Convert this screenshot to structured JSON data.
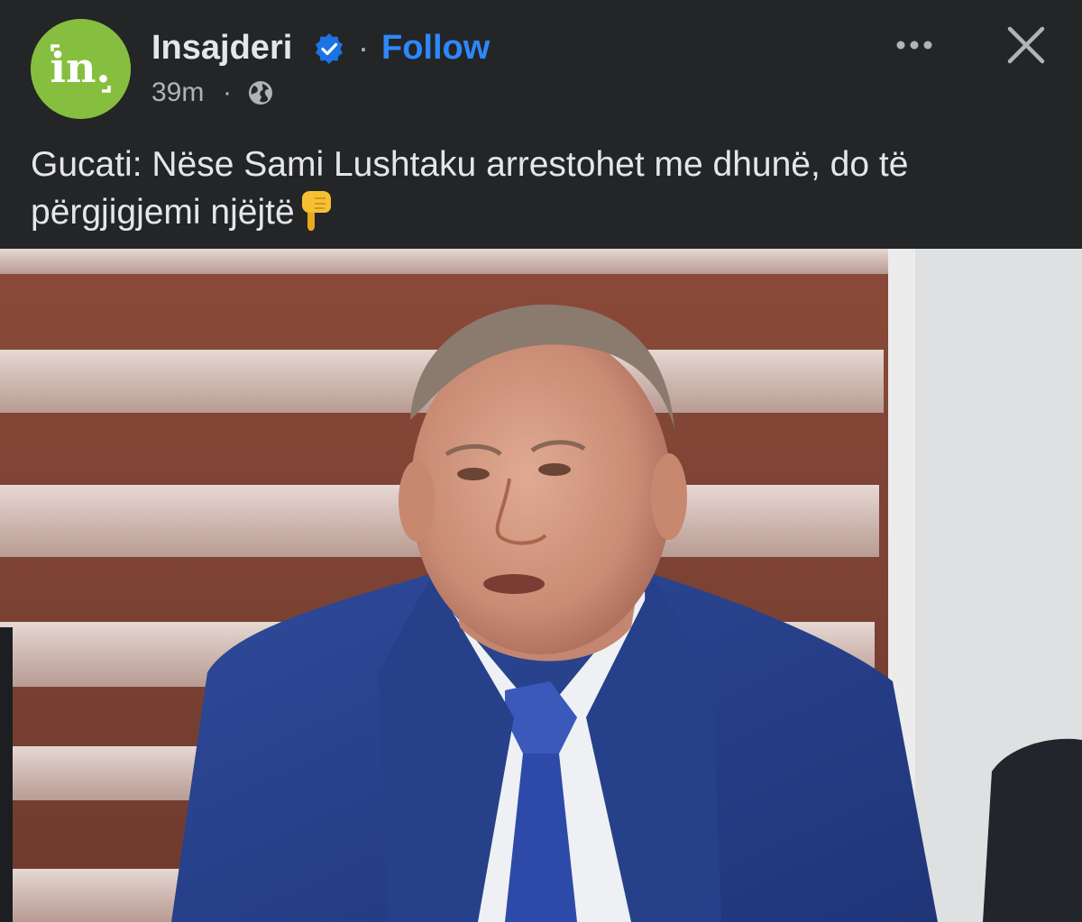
{
  "post": {
    "page_name": "Insajderi",
    "separator": "·",
    "follow_label": "Follow",
    "timestamp": "39m",
    "timestamp_separator": "·",
    "caption": "Gucati: Nëse Sami Lushtaku arrestohet me dhunë, do të përgjigjemi njëjtë",
    "avatar_text": "in."
  },
  "icons": {
    "verified": "verified-badge-icon",
    "audience": "globe-icon",
    "more": "more-options-icon",
    "close": "close-icon",
    "caption_emoji": "pointing-down-emoji"
  },
  "colors": {
    "background": "#242526",
    "text_primary": "#e4e6eb",
    "text_secondary": "#b0b3b8",
    "follow_blue": "#2d88ff",
    "verified_blue": "#1b74e4",
    "avatar_green": "#86bf3f"
  }
}
